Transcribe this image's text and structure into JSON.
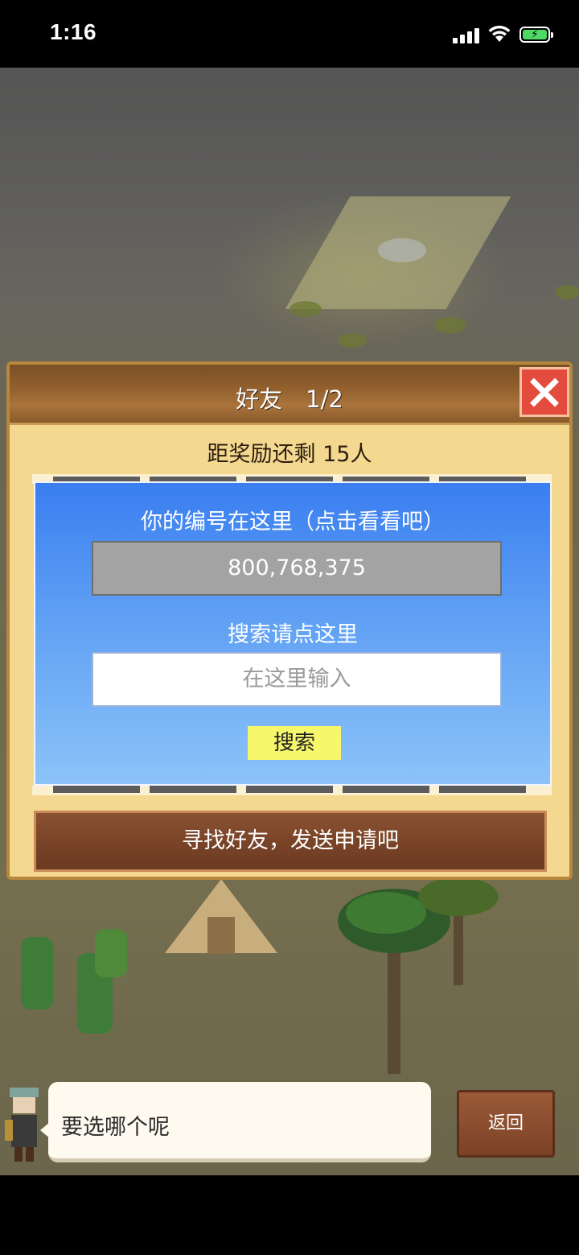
{
  "status_bar": {
    "time": "1:16",
    "battery_color": "#4cd964"
  },
  "dialog": {
    "title": "好友　1/2",
    "reward_text": "距奖励还剩 15人",
    "panel": {
      "title": "你的编号在这里（点击看看吧）",
      "id_value": "800,768,375",
      "search_label": "搜索请点这里",
      "search_placeholder": "在这里输入",
      "search_button": "搜索"
    },
    "find_button": "寻找好友，发送申请吧",
    "close_icon": "close-icon"
  },
  "message": {
    "text": "要选哪个呢",
    "back_button": "返回"
  },
  "colors": {
    "panel_blue": "#3a7ef0",
    "header_brown": "#925f2d",
    "dialog_parchment": "#f4d890",
    "close_red": "#e34b3c",
    "search_button_yellow": "#f6f76a"
  }
}
